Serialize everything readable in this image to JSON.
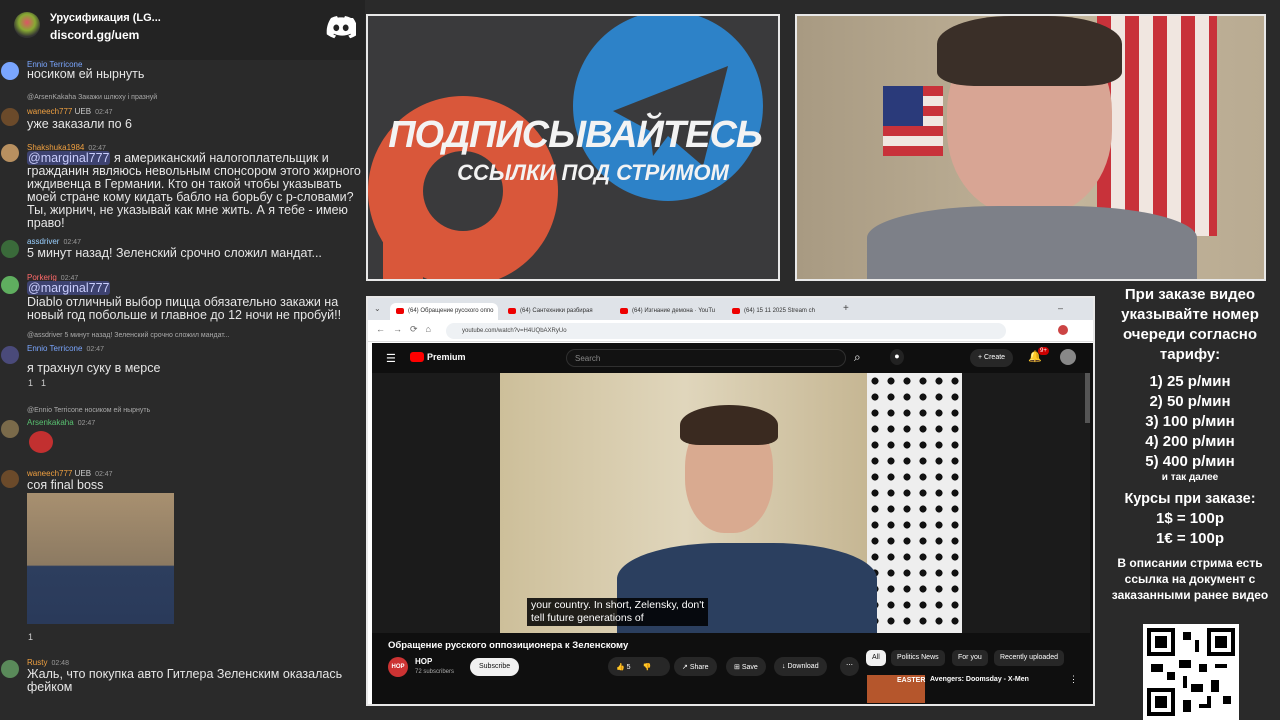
{
  "discord_header": {
    "server_name": "Урусификация (LG...",
    "invite": "discord.gg/uem",
    "logo_icon": "discord-icon"
  },
  "chat": {
    "top_line": {
      "username": "Ennio Terricone",
      "text": "носиком ей нырнуть"
    },
    "messages": [
      {
        "reply": "@ArsenKakaha Закажи шлюху і празнуй",
        "username": "waneech777",
        "badge": "UEB",
        "time": "02:47",
        "text": "уже заказали по 6",
        "color": "#f0a040"
      },
      {
        "username": "Shakshuka1984",
        "time": "02:47",
        "mention": "@marginal777",
        "text": " я американский налогоплательщик и гражданин являюсь невольным спонсором этого жирного иждивенца в Германии. Кто он такой чтобы указывать моей стране кому кидать бабло на борьбу с р-словами? Ты, жирнич, не указывай как мне жить. А я тебе - имею право!",
        "color": "#f0a040"
      },
      {
        "username": "assdriver",
        "time": "02:47",
        "text": "5 минут назад! Зеленский срочно сложил мандат...",
        "color": "#9ad0ff"
      },
      {
        "username": "Porkerig",
        "time": "02:47",
        "mention": "@marginal777",
        "text": "Diablo отличный выбор пицца обязательно закажи на новый год побольше и главное до 12 ночи не пробуй!!",
        "color": "#ff6a6a"
      },
      {
        "reply": "@assdriver 5 минут назад! Зеленский срочно сложил мандат...",
        "username": "Ennio Terricone",
        "time": "02:47",
        "text": "я трахнул суку в мерсе",
        "color": "#7aa6ff",
        "reactions": [
          "1",
          "1"
        ]
      },
      {
        "reply": "@Ennio Terricone носиком ей нырнуть",
        "username": "Arsenkakaha",
        "time": "02:47",
        "text": "",
        "color": "#58c070"
      },
      {
        "username": "waneech777",
        "badge": "UEB",
        "time": "02:47",
        "text": "соя final boss",
        "color": "#f0a040",
        "reactions": [
          "1"
        ]
      },
      {
        "username": "Rusty",
        "time": "02:48",
        "text": "Жаль, что покупка авто Гитлера Зеленским оказалась фейком",
        "color": "#f0a040"
      }
    ]
  },
  "promo": {
    "line1": "ПОДПИСЫВАЙТЕСЬ",
    "line2": "ССЫЛКИ ПОД СТРИМОМ"
  },
  "browser": {
    "tabs": [
      "(64) Обращение русского оппо",
      "(64) Сантехники разбирая",
      "(64) Изгнание демона · YouTu",
      "(64) 15 11 2025 Stream ch"
    ],
    "url": "youtube.com/watch?v=H4UQbAXRyUo",
    "youtube": {
      "brand": "Premium",
      "search_placeholder": "Search",
      "create": "Create",
      "notifications": "9+",
      "subtitle": "your country.  In short, Zelensky, don't\ntell future generations of",
      "video_title": "Обращение русского оппозиционера к Зеленскому",
      "channel": "HOP",
      "subscribers": "72 subscribers",
      "subscribe": "Subscribe",
      "likes": "5",
      "share": "Share",
      "save": "Save",
      "download": "Download",
      "chips": [
        "All",
        "Politics News",
        "For you",
        "Recently uploaded"
      ],
      "rec_title": "Avengers: Doomsday - X-Men",
      "rec_thumb_text": "EASTER"
    }
  },
  "pricing": {
    "header": "При заказе видео указывайте номер очереди согласно тарифу:",
    "tiers": [
      "1) 25 р/мин",
      "2) 50 р/мин",
      "3) 100 р/мин",
      "4) 200 р/мин",
      "5) 400 р/мин"
    ],
    "etc": "и так далее",
    "rates_header": "Курсы при заказе:",
    "rates": [
      "1$ = 100р",
      "1€ = 100р"
    ],
    "note": "В описании стрима есть ссылка на документ с заказанными ранее видео"
  }
}
